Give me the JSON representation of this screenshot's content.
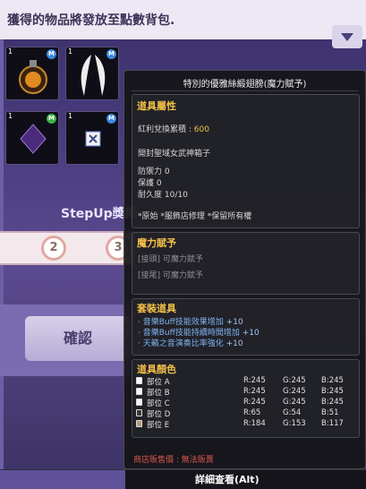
{
  "background": {
    "notice": "獲得的物品將發放至點數背包.",
    "step_label": "StepUp獎勵",
    "steps": [
      "2",
      "3"
    ],
    "confirm_label": "確認",
    "slots": [
      {
        "qty": "1",
        "badge": "M",
        "badge_color": "#3a8ae0",
        "icon": "potion-icon"
      },
      {
        "qty": "1",
        "badge": "M",
        "badge_color": "#3a8ae0",
        "icon": "wings-icon"
      },
      {
        "qty": "1",
        "badge": "M",
        "badge_color": "#3cb24a",
        "icon": "crystal-icon"
      },
      {
        "qty": "1",
        "badge": "M",
        "badge_color": "#3a8ae0",
        "icon": "scroll-icon"
      }
    ]
  },
  "tooltip": {
    "title": "特別的優雅絲緞翅膀(魔力賦予)",
    "attributes": {
      "header": "道具屬性",
      "points_label": "紅利兌換累積 :",
      "points_value": "600",
      "seal": "開封聖域女武神箱子",
      "defense_label": "防禦力",
      "defense_value": "0",
      "protect_label": "保護",
      "protect_value": "0",
      "durability_label": "耐久度",
      "durability_value": "10/10",
      "flags": "*原始 *服飾店修理 *保留所有權"
    },
    "enchant": {
      "header": "魔力賦予",
      "lines": [
        "[接頭] 可魔力賦予",
        "[接尾] 可魔力賦予"
      ]
    },
    "set": {
      "header": "套裝道具",
      "lines": [
        {
          "text": "音樂Buff技能效果增加",
          "value": "+10"
        },
        {
          "text": "音樂Buff技能持續時間增加",
          "value": "+10"
        },
        {
          "text": "天籟之音演奏比率強化",
          "value": "+10"
        }
      ]
    },
    "color": {
      "header": "道具顏色",
      "rows": [
        {
          "part": "部位 A",
          "r": "R:245",
          "g": "G:245",
          "b": "B:245",
          "swatch": "#f5f5f5"
        },
        {
          "part": "部位 B",
          "r": "R:245",
          "g": "G:245",
          "b": "B:245",
          "swatch": "#f5f5f5"
        },
        {
          "part": "部位 C",
          "r": "R:245",
          "g": "G:245",
          "b": "B:245",
          "swatch": "#f5f5f5"
        },
        {
          "part": "部位 D",
          "r": "R:65",
          "g": "G:54",
          "b": "B:51",
          "swatch": "#413633"
        },
        {
          "part": "部位 E",
          "r": "R:184",
          "g": "G:153",
          "b": "B:117",
          "swatch": "#b89975"
        }
      ]
    },
    "shop_sale": "商店販售價 : 無法販賣"
  },
  "bottom_bar": {
    "detail_label": "詳細查看(Alt)"
  },
  "colors": {
    "gold": "#f2c048",
    "blue_text": "#7fb4f0",
    "red_text": "#d6554c"
  }
}
